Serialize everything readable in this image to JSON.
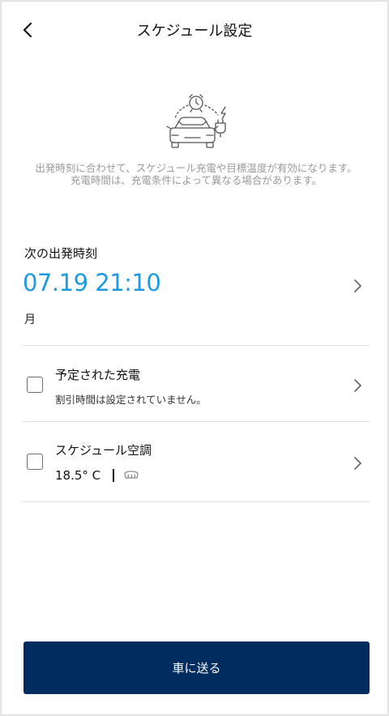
{
  "header": {
    "title": "スケジュール設定"
  },
  "info": {
    "line1": "出発時刻に合わせて、スケジュール充電や目標温度が有効になります。",
    "line2": "充電時間は、充電条件によって異なる場合があります。"
  },
  "departure": {
    "label": "次の出発時刻",
    "time": "07.19 21:10",
    "day": "月"
  },
  "scheduled_charging": {
    "title": "予定された充電",
    "subtitle": "割引時間は設定されていません。",
    "checked": false
  },
  "scheduled_climate": {
    "title": "スケジュール空調",
    "temperature": "18.5° C",
    "separator": "|",
    "defrost_icon": "defrost-icon",
    "checked": false
  },
  "footer": {
    "send_label": "車に送る"
  },
  "colors": {
    "accent": "#1e9be0",
    "primary_button": "#002c5f",
    "muted_text": "#9a9a9a",
    "divider": "#dedede"
  }
}
